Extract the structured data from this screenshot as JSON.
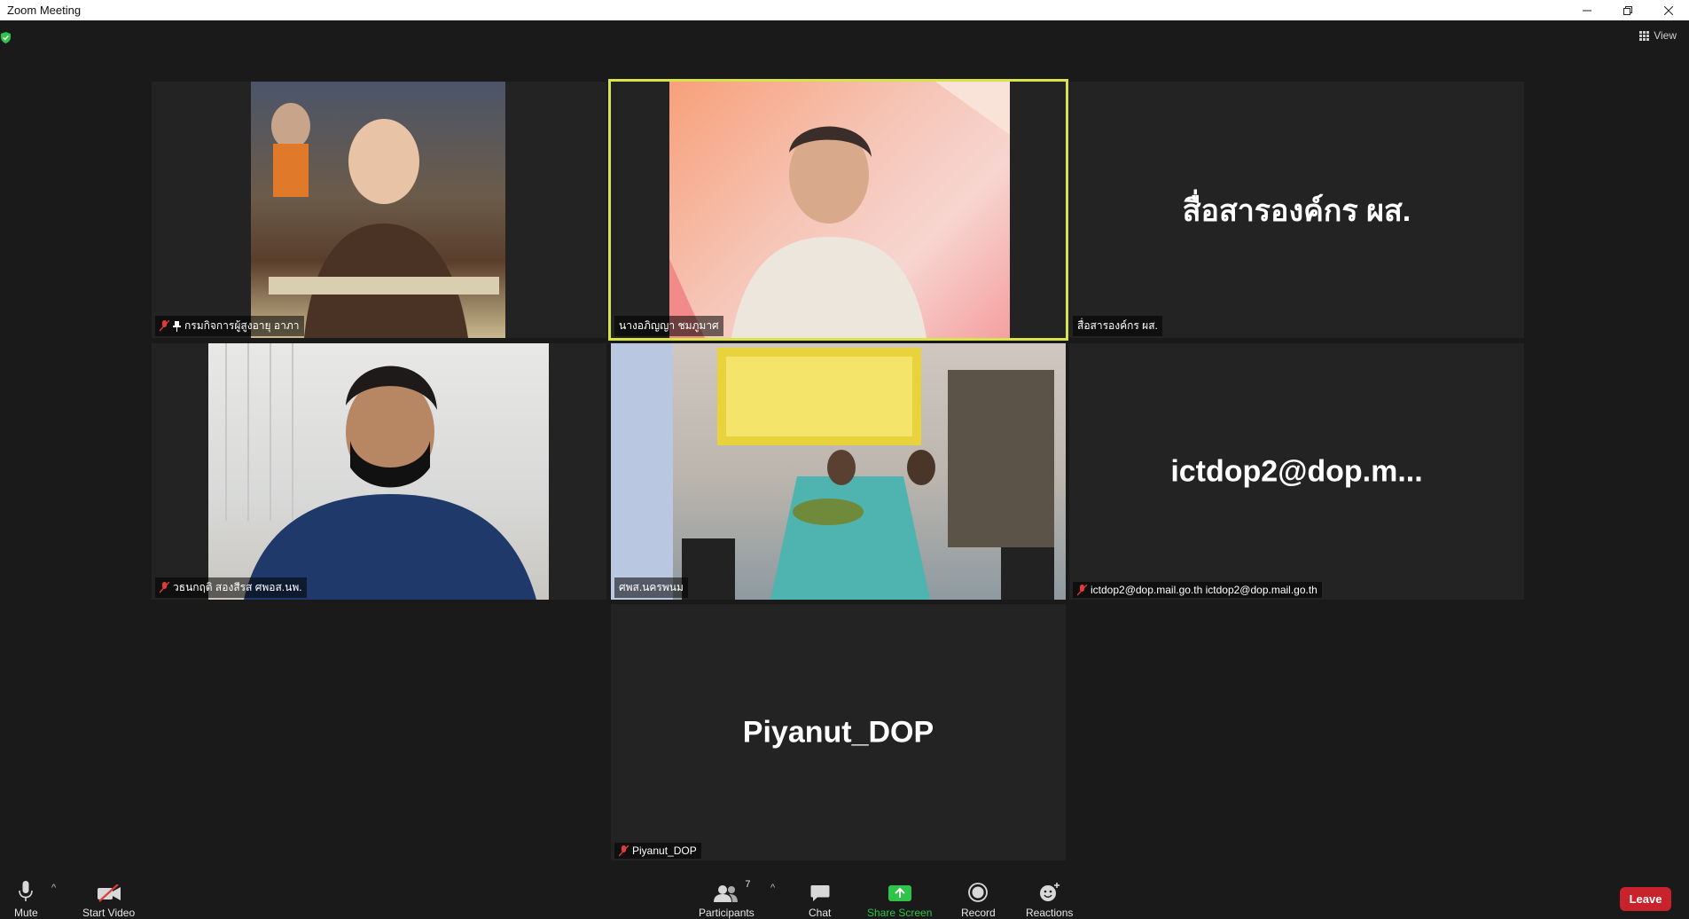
{
  "window": {
    "title": "Zoom Meeting"
  },
  "view": {
    "label": "View"
  },
  "tiles": [
    {
      "label": "กรมกิจการผู้สูงอายุ อาภา"
    },
    {
      "label": "นางอภิญญา ชมภูมาศ"
    },
    {
      "display_name": "สื่อสารองค์กร ผส.",
      "label": "สื่อสารองค์กร ผส."
    },
    {
      "label": "วธนกฤติ สองสีรส ศพอส.นพ."
    },
    {
      "label": "ศพส.นครพนม"
    },
    {
      "display_name": "ictdop2@dop.m...",
      "label": "ictdop2@dop.mail.go.th ictdop2@dop.mail.go.th"
    },
    {
      "display_name": "Piyanut_DOP",
      "label": "Piyanut_DOP"
    }
  ],
  "toolbar": {
    "mute": "Mute",
    "start_video": "Start Video",
    "participants": "Participants",
    "participants_count": "7",
    "chat": "Chat",
    "share_screen": "Share Screen",
    "record": "Record",
    "reactions": "Reactions",
    "leave": "Leave"
  },
  "colors": {
    "active_speaker": "#d8e24a",
    "share_green": "#2fc34a",
    "leave_red": "#c8232c"
  }
}
